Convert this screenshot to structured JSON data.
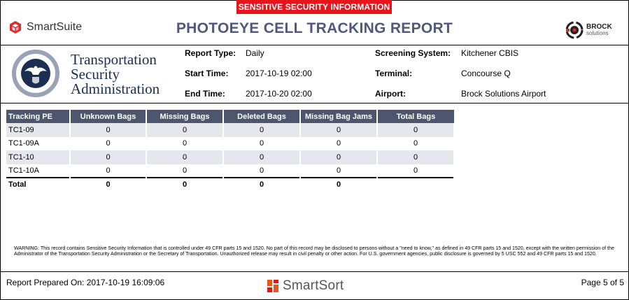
{
  "banner": "SENSITIVE SECURITY INFORMATION",
  "header": {
    "smartsuite_logo": "SmartSuite",
    "title": "PHOTOEYE CELL TRACKING REPORT",
    "brock_name": "BROCK",
    "brock_sub": "solutions"
  },
  "tsa": {
    "line1": "Transportation",
    "line2": "Security",
    "line3": "Administration",
    "seal_text": "U.S. DEPARTMENT OF HOMELAND SECURITY"
  },
  "meta": {
    "report_type_label": "Report Type:",
    "report_type": "Daily",
    "start_time_label": "Start Time:",
    "start_time": "2017-10-19 02:00",
    "end_time_label": "End Time:",
    "end_time": "2017-10-20 02:00",
    "screening_system_label": "Screening System:",
    "screening_system": "Kitchener CBIS",
    "terminal_label": "Terminal:",
    "terminal": "Concourse Q",
    "airport_label": "Airport:",
    "airport": "Brock Solutions Airport"
  },
  "table": {
    "headers": [
      "Tracking PE",
      "Unknown Bags",
      "Missing Bags",
      "Deleted Bags",
      "Missing Bag Jams",
      "Total Bags"
    ],
    "rows": [
      [
        "TC1-09",
        "0",
        "0",
        "0",
        "0",
        "0"
      ],
      [
        "TC1-09A",
        "0",
        "0",
        "0",
        "0",
        "0"
      ],
      [
        "TC1-10",
        "0",
        "0",
        "0",
        "0",
        "0"
      ],
      [
        "TC1-10A",
        "0",
        "0",
        "0",
        "0",
        "0"
      ]
    ],
    "total": [
      "Total",
      "0",
      "0",
      "0",
      "0",
      ""
    ]
  },
  "warning": "WARNING: This record contains Sensitive Security Information that is controlled under 49 CFR parts 15 and 1520. No part of this record may be disclosed to persons without a \"need to know,\" as defined in 49 CFR parts 15 and 1520, except with the written permission of the Administrator of the Transportation Security Administration or the Secretary of Transportation. Unauthorized release may result in civil penalty or other action. For U.S. government agencies, public disclosure is governed by 5 USC 552 and 49 CFR parts 15 and 1520.",
  "footer": {
    "prepared": "Report Prepared On: 2017-10-19 16:09:06",
    "logo": "SmartSort",
    "page": "Page 5 of 5"
  },
  "colors": {
    "banner_red": "#e8141b",
    "title_slate": "#50597a",
    "table_header": "#4e566e",
    "row_stripe": "#e6e7ec"
  }
}
